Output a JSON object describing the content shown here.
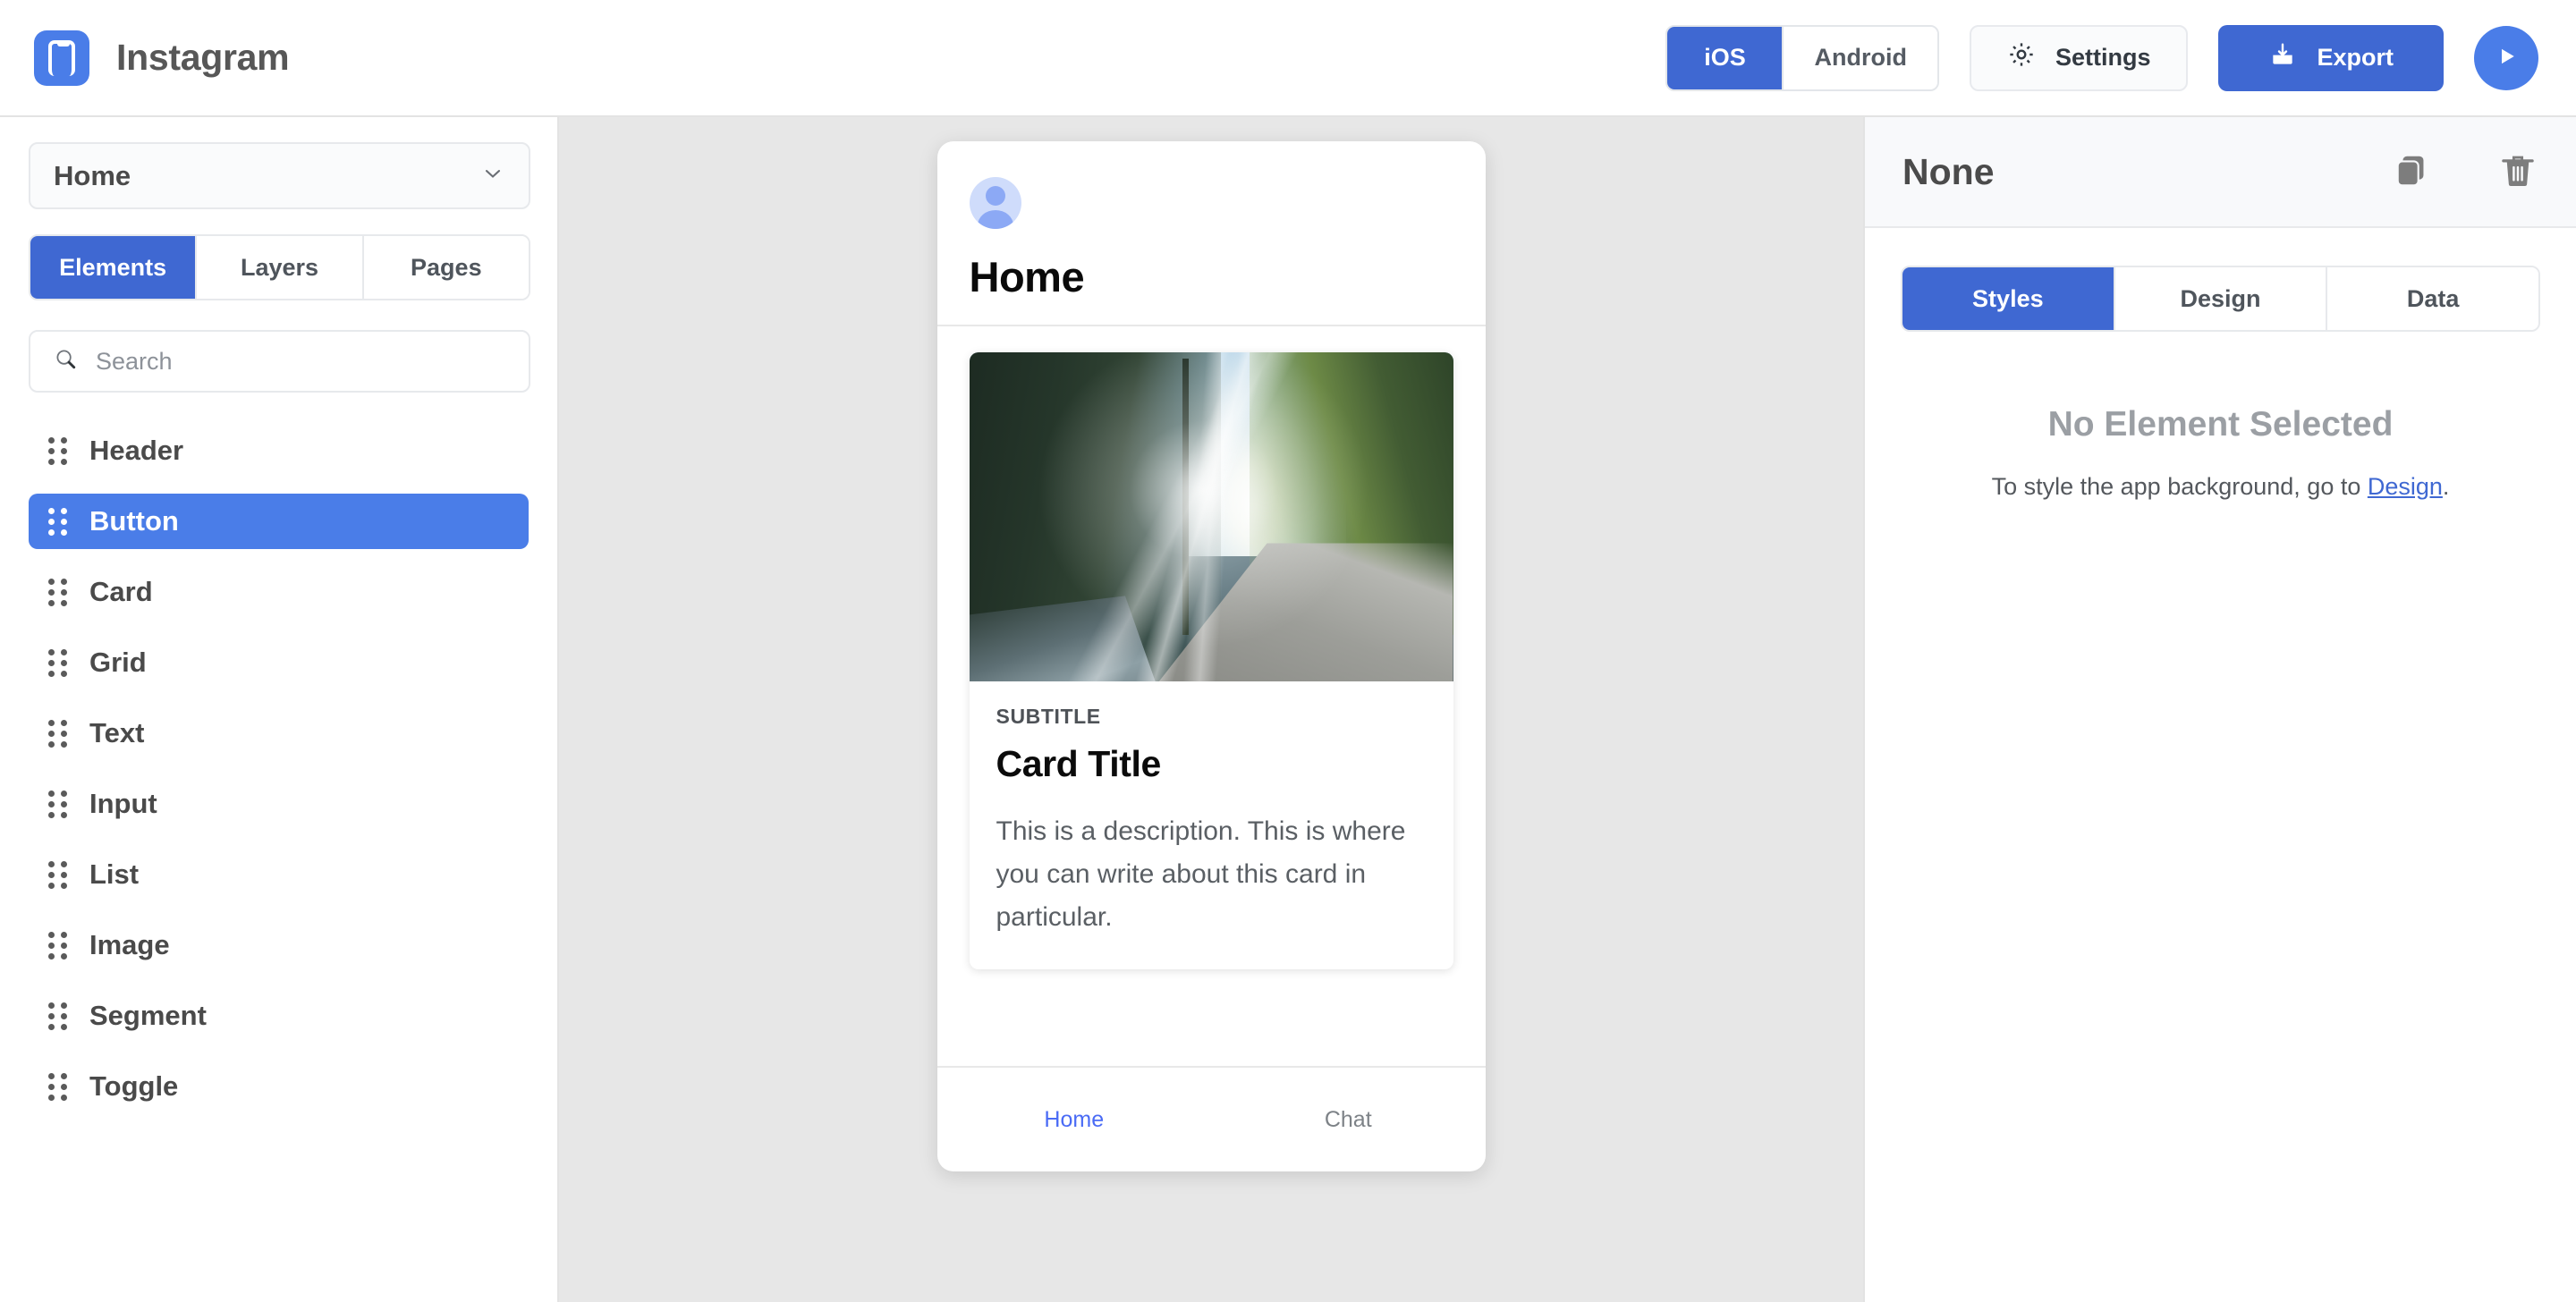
{
  "topbar": {
    "logo_icon": "phone-app-logo-icon",
    "app_title": "Instagram",
    "platform_tabs": [
      {
        "label": "iOS",
        "active": true
      },
      {
        "label": "Android",
        "active": false
      }
    ],
    "settings_label": "Settings",
    "settings_icon": "gear-icon",
    "export_label": "Export",
    "export_icon": "download-icon",
    "play_icon": "play-icon"
  },
  "sidebar": {
    "page_select_value": "Home",
    "page_select_icon": "chevron-down-icon",
    "tabs": [
      {
        "label": "Elements",
        "active": true
      },
      {
        "label": "Layers",
        "active": false
      },
      {
        "label": "Pages",
        "active": false
      }
    ],
    "search": {
      "placeholder": "Search",
      "value": "",
      "icon": "search-icon"
    },
    "elements": [
      {
        "label": "Header",
        "selected": false
      },
      {
        "label": "Button",
        "selected": true
      },
      {
        "label": "Card",
        "selected": false
      },
      {
        "label": "Grid",
        "selected": false
      },
      {
        "label": "Text",
        "selected": false
      },
      {
        "label": "Input",
        "selected": false
      },
      {
        "label": "List",
        "selected": false
      },
      {
        "label": "Image",
        "selected": false
      },
      {
        "label": "Segment",
        "selected": false
      },
      {
        "label": "Toggle",
        "selected": false
      }
    ]
  },
  "preview": {
    "avatar_icon": "user-avatar-icon",
    "screen_title": "Home",
    "card": {
      "image_alt": "forest-road-sunbeams-photo",
      "subtitle": "SUBTITLE",
      "title": "Card Title",
      "description": "This is a description. This is where you can write about this card in particular."
    },
    "tabbar": [
      {
        "label": "Home",
        "active": true
      },
      {
        "label": "Chat",
        "active": false
      }
    ]
  },
  "inspector": {
    "title": "None",
    "duplicate_icon": "copy-icon",
    "delete_icon": "trash-icon",
    "tabs": [
      {
        "label": "Styles",
        "active": true
      },
      {
        "label": "Design",
        "active": false
      },
      {
        "label": "Data",
        "active": false
      }
    ],
    "empty_title": "No Element Selected",
    "empty_text_before": "To style the app background, go to ",
    "empty_link": "Design",
    "empty_text_after": "."
  },
  "colors": {
    "accent_blue": "#3f68d2",
    "bright_blue": "#4a7de8",
    "canvas_gray": "#e7e7e7",
    "panel_header": "#f8f9fb",
    "link_blue": "#4a6bf5"
  }
}
